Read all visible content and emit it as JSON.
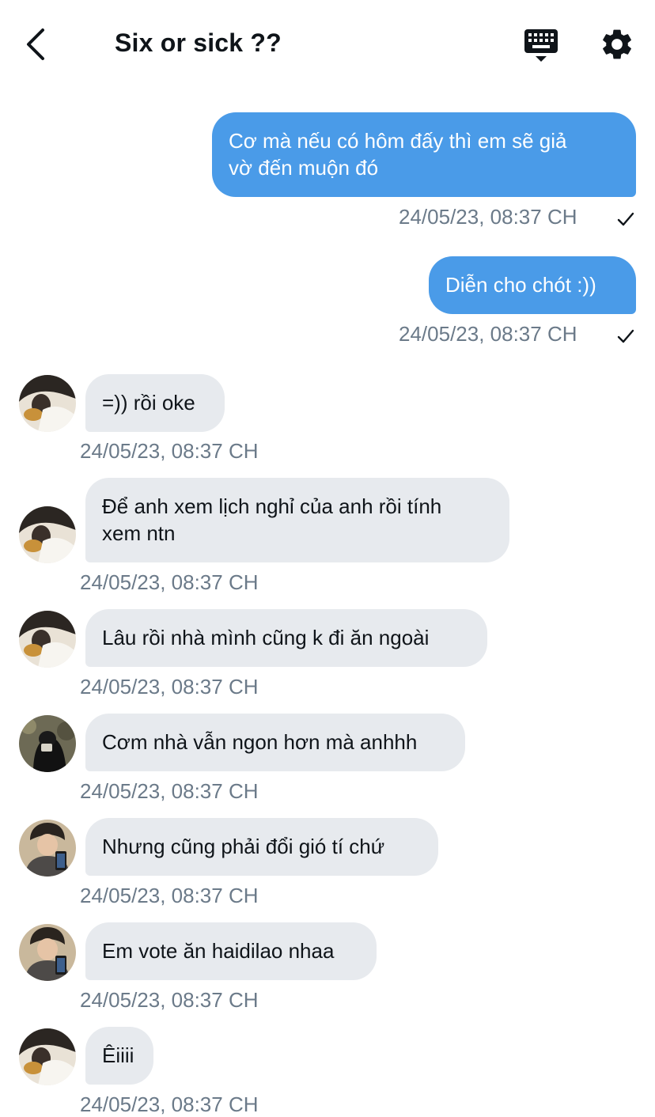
{
  "header": {
    "title": "Six or sick ??",
    "back_icon": "chevron-left-icon",
    "keyboard_icon": "keyboard-icon",
    "settings_icon": "gear-icon"
  },
  "colors": {
    "outgoing_bubble": "#4a9be8",
    "incoming_bubble": "#e7eaee",
    "timestamp": "#6b7a89"
  },
  "messages": [
    {
      "direction": "out",
      "text": "Cơ mà nếu có hôm đấy thì em sẽ giả\nvờ đến muộn đó",
      "time": "24/05/23, 08:37 CH",
      "read": true
    },
    {
      "direction": "out",
      "text": "Diễn cho chót :))",
      "time": "24/05/23, 08:37 CH",
      "read": true
    },
    {
      "direction": "in",
      "text": "=)) rồi oke",
      "time": "24/05/23, 08:37 CH",
      "avatar": "avatar-a"
    },
    {
      "direction": "in",
      "text": "Để anh xem lịch nghỉ của anh rồi tính\nxem ntn",
      "time": "24/05/23, 08:37 CH",
      "avatar": "avatar-a"
    },
    {
      "direction": "in",
      "text": "Lâu rồi nhà mình cũng k đi ăn ngoài",
      "time": "24/05/23, 08:37 CH",
      "avatar": "avatar-a"
    },
    {
      "direction": "in",
      "text": "Cơm nhà vẫn ngon hơn mà anhhh",
      "time": "24/05/23, 08:37 CH",
      "avatar": "avatar-b"
    },
    {
      "direction": "in",
      "text": "Nhưng cũng phải đổi gió tí chứ",
      "time": "24/05/23, 08:37 CH",
      "avatar": "avatar-c"
    },
    {
      "direction": "in",
      "text": "Em vote ăn haidilao nhaa",
      "time": "24/05/23, 08:37 CH",
      "avatar": "avatar-c"
    },
    {
      "direction": "in",
      "text": "Êiiii",
      "time": "24/05/23, 08:37 CH",
      "avatar": "avatar-a"
    }
  ]
}
